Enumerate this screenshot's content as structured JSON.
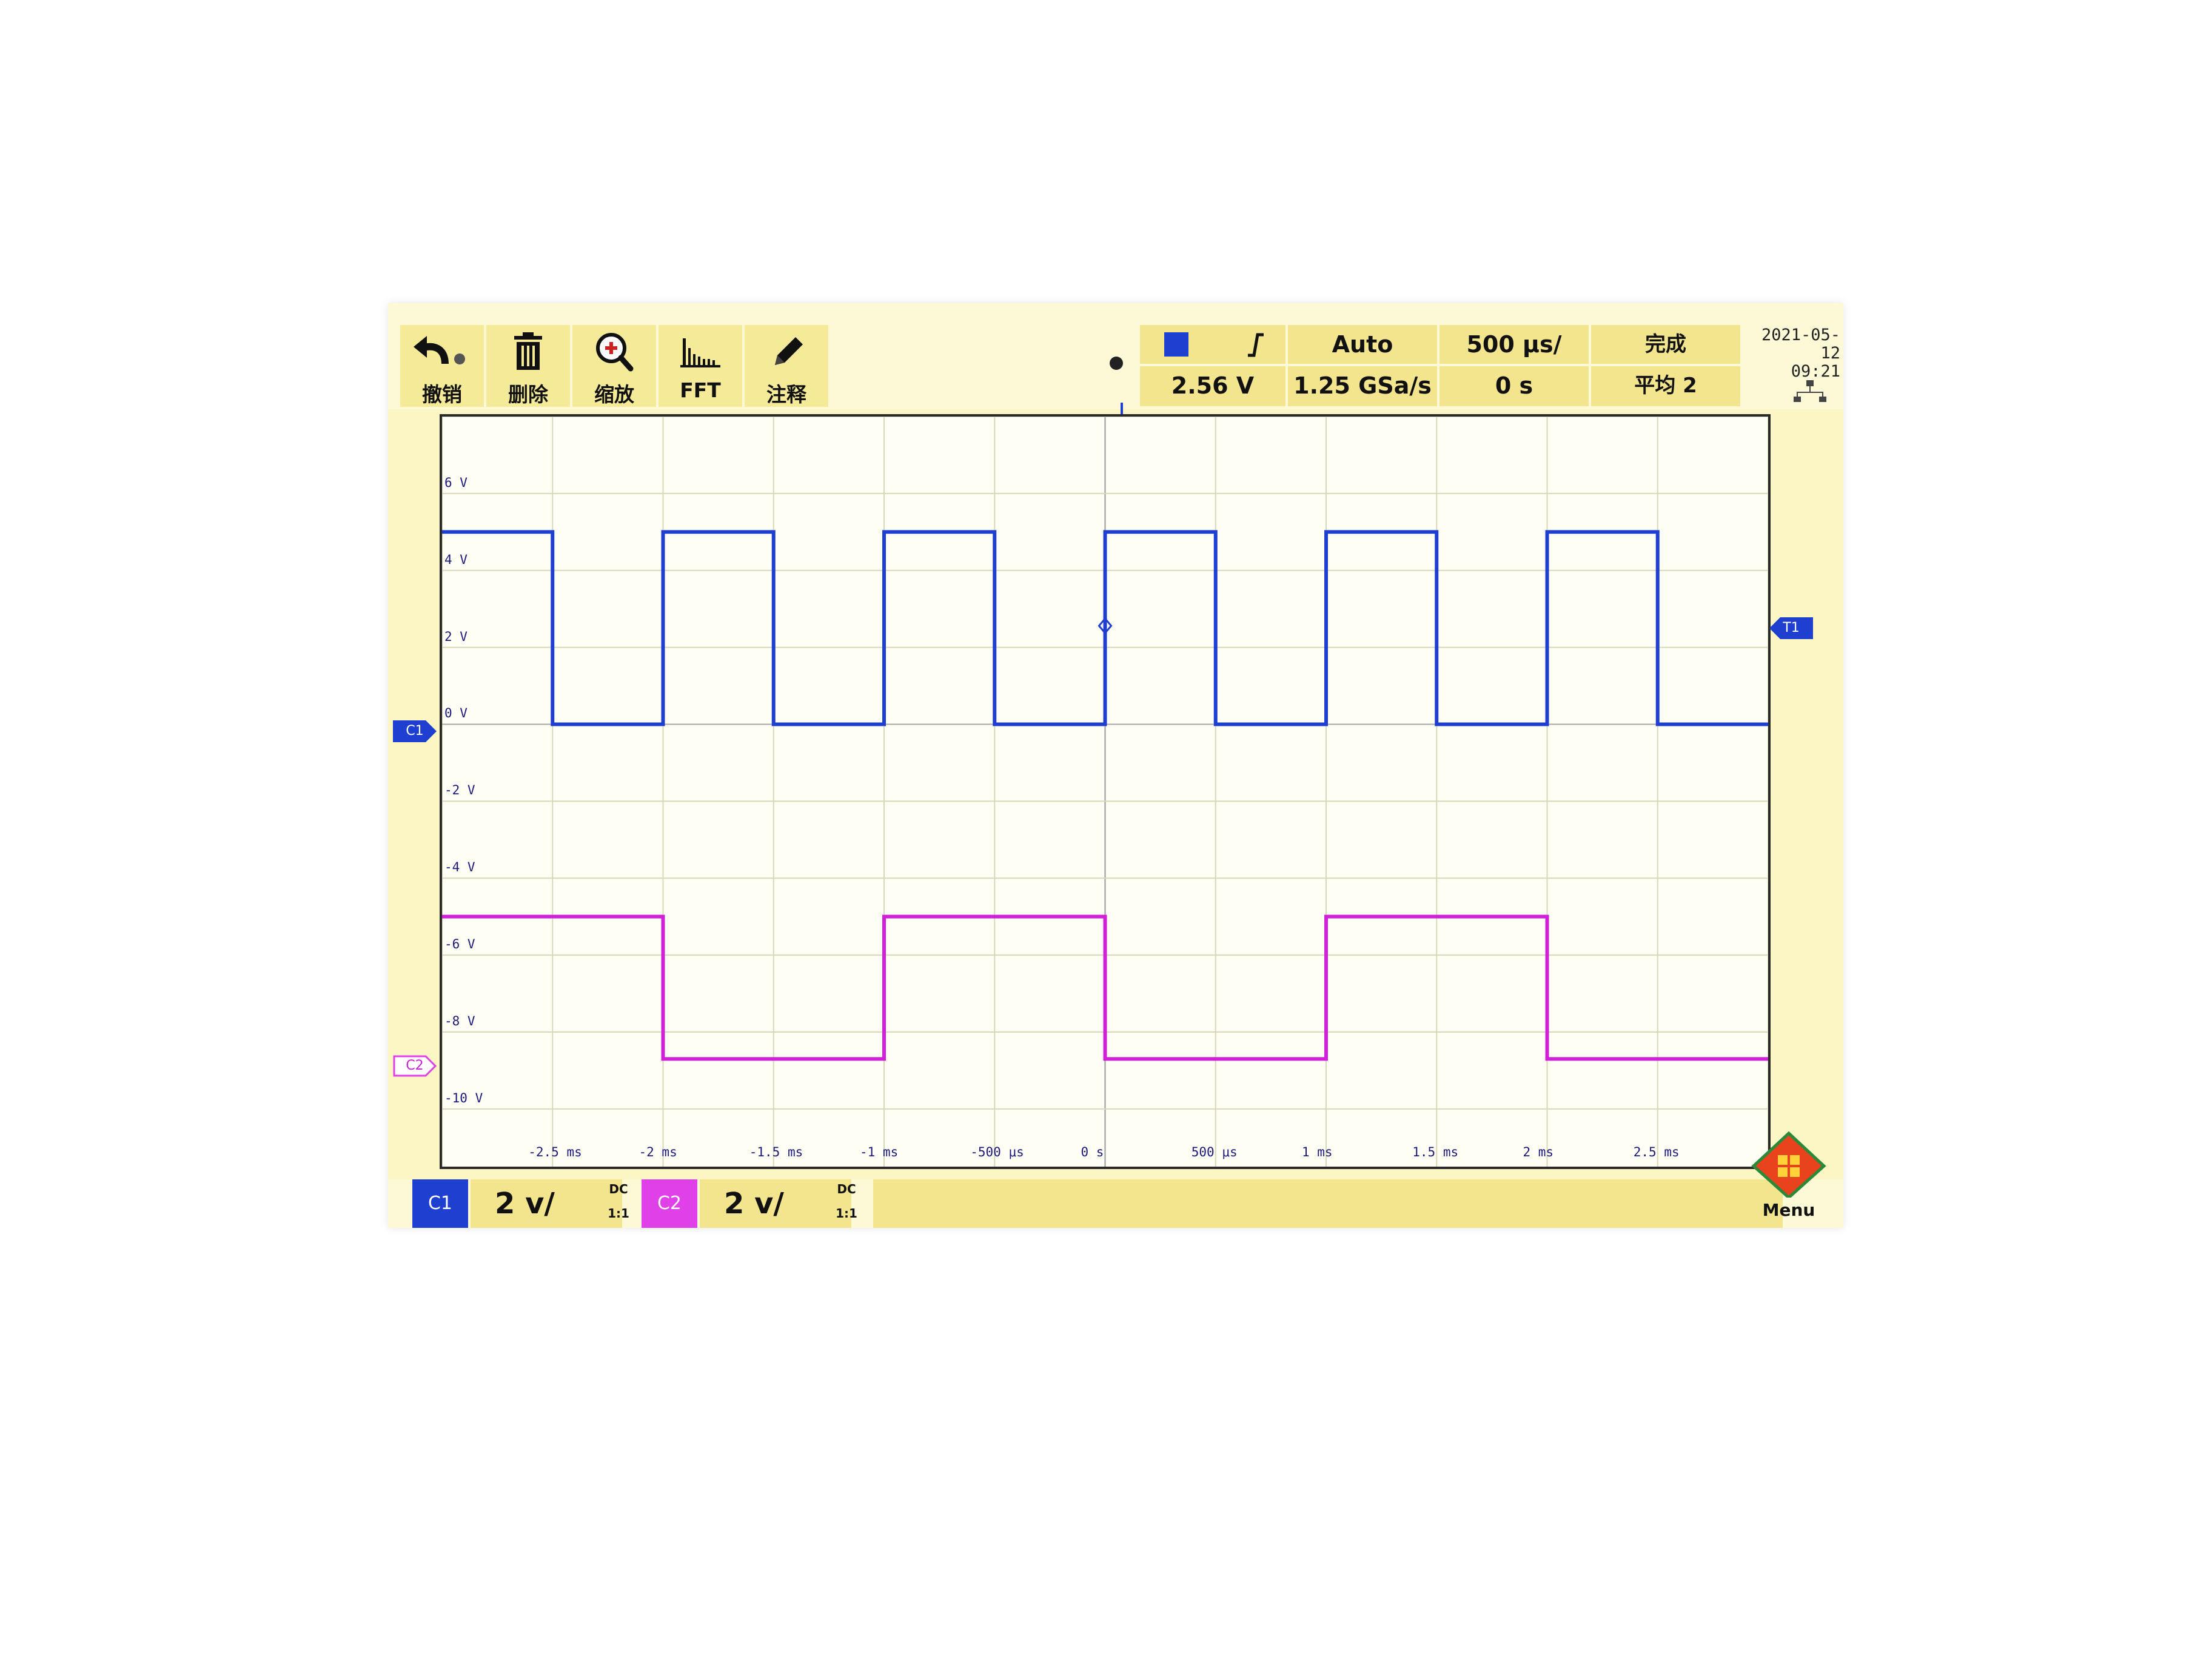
{
  "toolbar": {
    "items": [
      {
        "label": "撤销",
        "icon": "undo-icon"
      },
      {
        "label": "删除",
        "icon": "trash-icon"
      },
      {
        "label": "缩放",
        "icon": "zoom-icon"
      },
      {
        "label": "FFT",
        "icon": "fft-icon"
      },
      {
        "label": "注释",
        "icon": "pencil-icon"
      }
    ]
  },
  "status": {
    "trigger_source_color": "#1f3fd0",
    "trigger_edge_icon": "rising-edge-icon",
    "trigger_level": "2.56 V",
    "trigger_mode": "Auto",
    "sample_rate": "1.25 GSa/s",
    "timebase": "500 μs/",
    "delay": "0 s",
    "acq_state": "完成",
    "acq_mode": "平均 2"
  },
  "datetime": {
    "date": "2021-05-12",
    "time": "09:21"
  },
  "plot": {
    "v_labels": [
      "6 V",
      "4 V",
      "2 V",
      "0 V",
      "-2 V",
      "-4 V",
      "-6 V",
      "-8 V",
      "-10 V"
    ],
    "t_labels": [
      "-2.5 ms",
      "-2 ms",
      "-1.5 ms",
      "-1 ms",
      "-500 μs",
      "0 s",
      "500 μs",
      "1 ms",
      "1.5 ms",
      "2 ms",
      "2.5 ms"
    ],
    "c1_marker": "C1",
    "c2_marker": "C2",
    "trigger_marker": "T1"
  },
  "chart_data": {
    "type": "line",
    "xlabel": "",
    "ylabel": "",
    "xlim": [
      -3.0,
      3.0
    ],
    "ylim": [
      -11.5,
      8.0
    ],
    "grid": true,
    "series": [
      {
        "name": "C1",
        "color": "#1f3fd0",
        "x": [
          -3.0,
          -2.5,
          -2.5,
          -2.0,
          -2.0,
          -1.5,
          -1.5,
          -1.0,
          -1.0,
          -0.5,
          -0.5,
          0.0,
          0.0,
          0.5,
          0.5,
          1.0,
          1.0,
          1.5,
          1.5,
          2.0,
          2.0,
          2.5,
          2.5,
          3.0
        ],
        "y": [
          5.0,
          5.0,
          0.0,
          0.0,
          5.0,
          5.0,
          0.0,
          0.0,
          5.0,
          5.0,
          0.0,
          0.0,
          5.0,
          5.0,
          0.0,
          0.0,
          5.0,
          5.0,
          0.0,
          0.0,
          5.0,
          5.0,
          0.0,
          0.0
        ]
      },
      {
        "name": "C2",
        "color": "#d020d8",
        "x": [
          -3.0,
          -2.0,
          -2.0,
          -1.0,
          -1.0,
          0.0,
          0.0,
          1.0,
          1.0,
          2.0,
          2.0,
          3.0
        ],
        "y": [
          -5.0,
          -5.0,
          -8.7,
          -8.7,
          -5.0,
          -5.0,
          -8.7,
          -8.7,
          -5.0,
          -5.0,
          -8.7,
          -8.7
        ]
      }
    ]
  },
  "bottom": {
    "c1": {
      "chip": "C1",
      "scale": "2 v/",
      "coupling": "DC",
      "probe": "1:1",
      "color": "#1f3fd0"
    },
    "c2": {
      "chip": "C2",
      "scale": "2 v/",
      "coupling": "DC",
      "probe": "1:1",
      "color": "#e040e8"
    },
    "menu_label": "Menu"
  }
}
